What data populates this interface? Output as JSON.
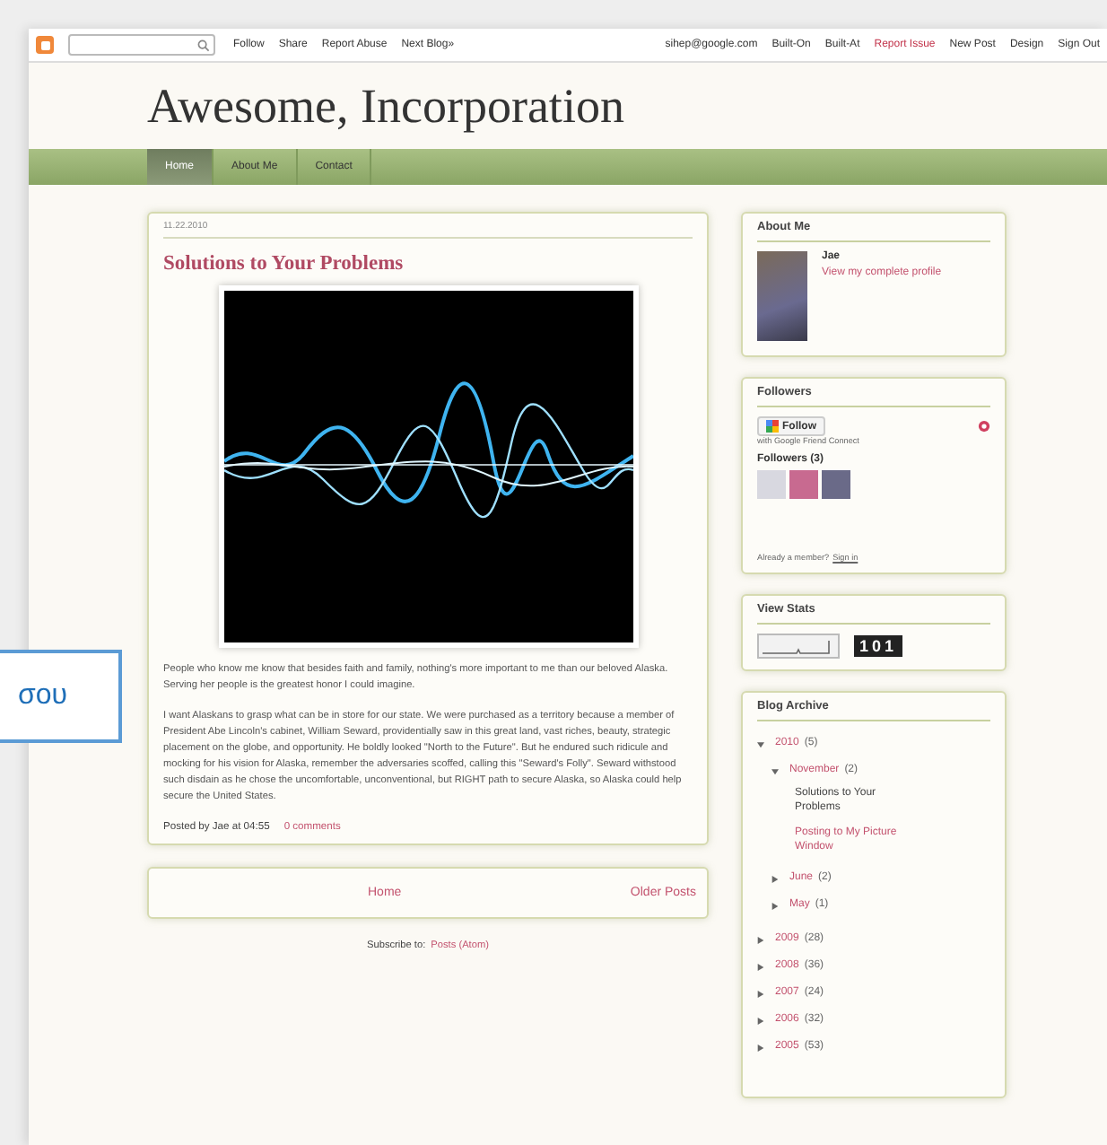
{
  "navbar": {
    "left_links": [
      "Follow",
      "Share",
      "Report Abuse",
      "Next Blog»"
    ],
    "right_links": [
      {
        "label": "sihep@google.com",
        "alert": false
      },
      {
        "label": "Built-On",
        "alert": false
      },
      {
        "label": "Built-At",
        "alert": false
      },
      {
        "label": "Report Issue",
        "alert": true
      },
      {
        "label": "New Post",
        "alert": false
      },
      {
        "label": "Design",
        "alert": false
      },
      {
        "label": "Sign Out",
        "alert": false
      }
    ]
  },
  "blog_title": "Awesome, Incorporation",
  "tabs": [
    {
      "label": "Home",
      "selected": true
    },
    {
      "label": "About Me",
      "selected": false
    },
    {
      "label": "Contact",
      "selected": false
    }
  ],
  "post": {
    "date": "11.22.2010",
    "title": "Solutions to Your Problems",
    "paragraphs": [
      "People who know me know that besides faith and family, nothing's more important to me than our beloved Alaska. Serving her people is the greatest honor I could imagine.",
      "I want Alaskans to grasp what can be in store for our state. We were purchased as a territory because a member of President Abe Lincoln's cabinet, William Seward, providentially saw in this great land, vast riches, beauty, strategic placement on the globe, and opportunity. He boldly looked \"North to the Future\". But he endured such ridicule and mocking for his vision for Alaska, remember the adversaries scoffed, calling this \"Seward's Folly\". Seward withstood such disdain as he chose the uncomfortable, unconventional, but RIGHT path to secure Alaska, so Alaska could help secure the United States."
    ],
    "byline": "Posted by Jae at 04:55",
    "comments": "0 comments"
  },
  "pager": {
    "home": "Home",
    "older": "Older Posts"
  },
  "subscribe": {
    "label": "Subscribe to:",
    "link": "Posts (Atom)"
  },
  "about_me": {
    "title": "About Me",
    "name": "Jae",
    "profile_link": "View my complete profile"
  },
  "followers": {
    "title": "Followers",
    "follow_button": "Follow",
    "subtitle": "with Google Friend Connect",
    "count_label": "Followers (3)",
    "member_text": "Already a member?",
    "sign_in": "Sign in"
  },
  "view_stats": {
    "title": "View Stats",
    "counter": "101"
  },
  "blog_archive": {
    "title": "Blog Archive",
    "items": [
      {
        "label": "2010",
        "count": "(5)",
        "expanded": true,
        "children": [
          {
            "label": "November",
            "count": "(2)",
            "expanded": true,
            "posts": [
              {
                "label": "Solutions to Your Problems",
                "selected": true
              },
              {
                "label": "Posting to My Picture Window",
                "selected": false
              }
            ]
          },
          {
            "label": "June",
            "count": "(2)",
            "expanded": false
          },
          {
            "label": "May",
            "count": "(1)",
            "expanded": false
          }
        ]
      },
      {
        "label": "2009",
        "count": "(28)",
        "expanded": false
      },
      {
        "label": "2008",
        "count": "(36)",
        "expanded": false
      },
      {
        "label": "2007",
        "count": "(24)",
        "expanded": false
      },
      {
        "label": "2006",
        "count": "(32)",
        "expanded": false
      },
      {
        "label": "2005",
        "count": "(53)",
        "expanded": false
      }
    ]
  },
  "overlay_label": "σου"
}
